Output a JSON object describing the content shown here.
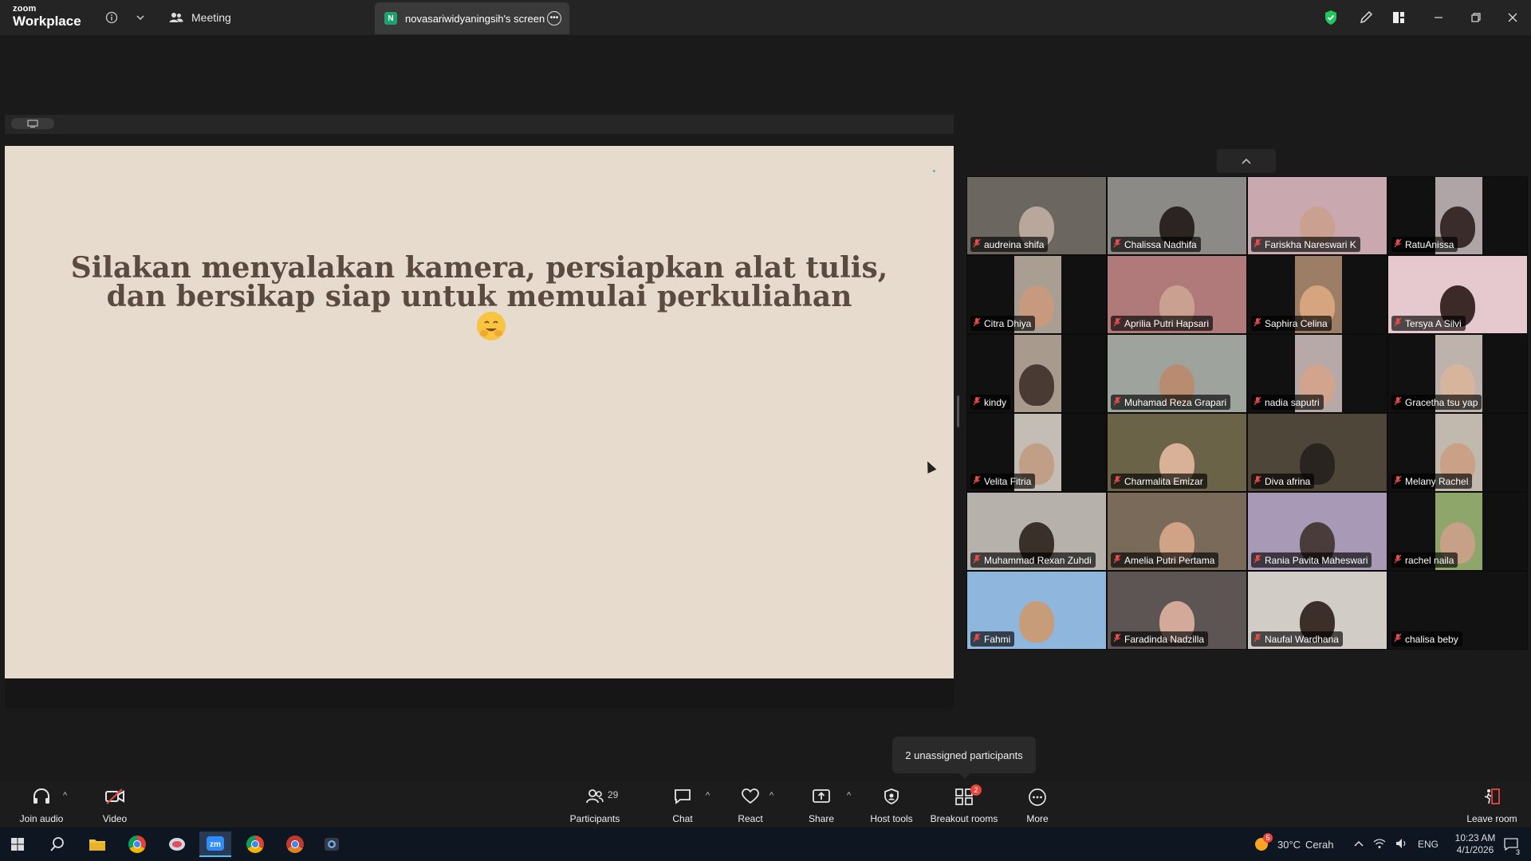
{
  "titlebar": {
    "logo_line1": "zoom",
    "logo_line2": "Workplace",
    "meeting_label": "Meeting",
    "screen_tab_label": "novasariwidyaningsih's screen",
    "screen_tab_initial": "N"
  },
  "slide": {
    "line1": "Silakan menyalakan kamera, persiapkan alat tulis,",
    "line2": "dan bersikap siap untuk memulai perkuliahan"
  },
  "participants": [
    {
      "name": "audreina shifa",
      "bg": "#6b6760",
      "skin": "#b8a79a"
    },
    {
      "name": "Chalissa Nadhifa",
      "bg": "#8c8a86",
      "skin": "#2b2422"
    },
    {
      "name": "Fariskha Nareswari K",
      "bg": "#c9a8b0",
      "skin": "#caa091"
    },
    {
      "name": "RatuAnissa",
      "bg": "#b0a5a6",
      "skin": "#3a2c2a"
    },
    {
      "name": "Citra Dhiya",
      "bg": "#a89e92",
      "skin": "#c79a80"
    },
    {
      "name": "Aprilia Putri Hapsari",
      "bg": "#b07a7a",
      "skin": "#caa090"
    },
    {
      "name": "Saphira Celina",
      "bg": "#9c7d66",
      "skin": "#d6a47f"
    },
    {
      "name": "Tersya A Silvi",
      "bg": "#e6c9cf",
      "skin": "#3b2a27"
    },
    {
      "name": "kindy",
      "bg": "#a99a8e",
      "skin": "#4a3a34"
    },
    {
      "name": "Muhamad Reza Grapari",
      "bg": "#9ea39e",
      "skin": "#b88c70"
    },
    {
      "name": "nadia saputri",
      "bg": "#b7a9a8",
      "skin": "#d3a48d"
    },
    {
      "name": "Gracetha tsu yap",
      "bg": "#bdb3ac",
      "skin": "#d7b49c"
    },
    {
      "name": "Velita Fitria",
      "bg": "#c4bdb6",
      "skin": "#c19f87"
    },
    {
      "name": "Charmalita Emizar",
      "bg": "#6b6348",
      "skin": "#d8b198"
    },
    {
      "name": "Diva afrina",
      "bg": "#4e4638",
      "skin": "#2a2420"
    },
    {
      "name": "Melany Rachel",
      "bg": "#c1b8ae",
      "skin": "#caa086"
    },
    {
      "name": "Muhammad Rexan Zuhdi",
      "bg": "#b6b1ab",
      "skin": "#3a302a"
    },
    {
      "name": "Amelia Putri Pertama",
      "bg": "#7a6a5a",
      "skin": "#d1a386"
    },
    {
      "name": "Rania Pavita Maheswari",
      "bg": "#a89ab6",
      "skin": "#4a3c3a"
    },
    {
      "name": "rachel naila",
      "bg": "#8ea66a",
      "skin": "#c7a088"
    },
    {
      "name": "Fahmi",
      "bg": "#8fb6dc",
      "skin": "#c79c78"
    },
    {
      "name": "Faradinda Nadzilla",
      "bg": "#5d5553",
      "skin": "#d3a999"
    },
    {
      "name": "Naufal Wardhana",
      "bg": "#d1ccc6",
      "skin": "#3c2e28"
    },
    {
      "name": "chalisa beby",
      "bg": "#121212",
      "skin": "#121212"
    }
  ],
  "tooltip": "2 unassigned participants",
  "toolbar": {
    "join_audio": "Join audio",
    "video": "Video",
    "participants": "Participants",
    "participants_count": "29",
    "chat": "Chat",
    "react": "React",
    "share": "Share",
    "host_tools": "Host tools",
    "breakout_rooms": "Breakout rooms",
    "breakout_badge": "2",
    "more": "More",
    "leave_room": "Leave room"
  },
  "taskbar": {
    "weather_temp": "30°C",
    "weather_desc": "Cerah",
    "weather_badge": "5",
    "lang": "ENG",
    "time": "10:23 AM",
    "date": "4/1/2026",
    "notifications": "3"
  }
}
